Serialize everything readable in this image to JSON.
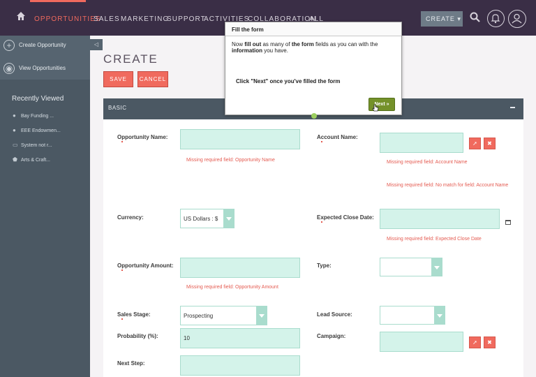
{
  "nav": {
    "items": [
      "OPPORTUNITIES",
      "SALES",
      "MARKETING",
      "SUPPORT",
      "ACTIVITIES",
      "COLLABORATION",
      "ALL"
    ],
    "create_label": "CREATE ▾",
    "colors": {
      "bg": "#3a2e46",
      "accent": "#f06a5e"
    }
  },
  "sidebar": {
    "actions": [
      "Create Opportunity",
      "View Opportunities"
    ],
    "recent_title": "Recently Viewed",
    "recent": [
      {
        "label": "Bay Funding ...",
        "icon": "lightbulb-icon"
      },
      {
        "label": "EEE Endowmen...",
        "icon": "lightbulb-icon"
      },
      {
        "label": "System not r...",
        "icon": "folder-icon"
      },
      {
        "label": "Arts & Craft...",
        "icon": "shield-icon"
      }
    ]
  },
  "page": {
    "title": "CREATE",
    "save": "SAVE",
    "cancel": "CANCEL",
    "panel_title": "BASIC"
  },
  "form": {
    "opp_name": {
      "label": "Opportunity Name:",
      "value": "",
      "error": "Missing required field: Opportunity Name"
    },
    "account_name": {
      "label": "Account Name:",
      "value": "",
      "errors": [
        "Missing required field: Account Name",
        "Missing required field: No match for field: Account Name"
      ]
    },
    "currency": {
      "label": "Currency:",
      "value": "US Dollars : $"
    },
    "close_date": {
      "label": "Expected Close Date:",
      "value": "",
      "error": "Missing required field: Expected Close Date"
    },
    "amount": {
      "label": "Opportunity Amount:",
      "value": "",
      "error": "Missing required field: Opportunity Amount"
    },
    "type": {
      "label": "Type:",
      "value": ""
    },
    "sales_stage": {
      "label": "Sales Stage:",
      "value": "Prospecting"
    },
    "lead_source": {
      "label": "Lead Source:",
      "value": ""
    },
    "probability": {
      "label": "Probability (%):",
      "value": "10"
    },
    "campaign": {
      "label": "Campaign:",
      "value": ""
    },
    "next_step": {
      "label": "Next Step:",
      "value": ""
    }
  },
  "tour": {
    "title": "Fill the form",
    "body_1": "Now ",
    "body_b1": "fill out",
    "body_2": " as many of ",
    "body_b2": "the form",
    "body_3": " fields as you can with the ",
    "body_b3": "information",
    "body_4": " you have.",
    "note": "Click \"Next\" once you've filled the form",
    "next": "Next »"
  }
}
